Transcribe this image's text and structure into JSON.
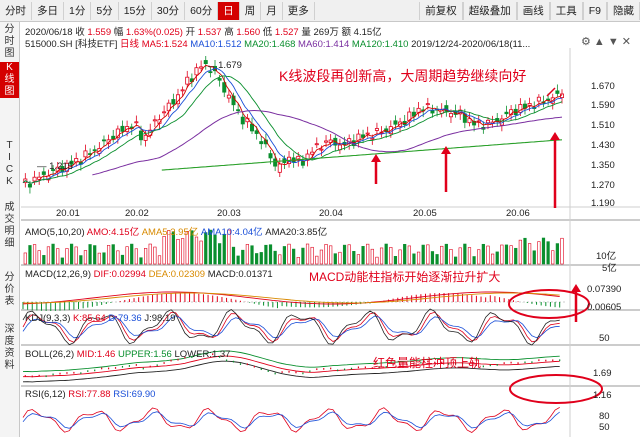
{
  "toolbar": {
    "left": [
      "分时",
      "多日",
      "1分",
      "5分",
      "15分",
      "30分",
      "60分",
      "日",
      "周",
      "月",
      "更多"
    ],
    "active": "日",
    "right": [
      "前复权",
      "超级叠加",
      "画线",
      "工具",
      "F9",
      "隐藏"
    ]
  },
  "sidebar": [
    {
      "label": "分\n时\n图",
      "active": false
    },
    {
      "label": "K\n线\n图",
      "active": true
    },
    {
      "label": "T\nI\nC\nK",
      "active": false
    },
    {
      "label": "成\n交\n明\n细",
      "active": false
    },
    {
      "label": "分\n价\n表",
      "active": false
    },
    {
      "label": "深\n度\n资\n料",
      "active": false
    }
  ],
  "header": {
    "date": "2020/06/18",
    "close_label": "收",
    "close_value": "1.559",
    "change_label": "幅",
    "change_value": "1.63%(0.025)",
    "open_label": "开",
    "open_value": "1.537",
    "high_label": "高",
    "high_value": "1.560",
    "low_label": "低",
    "low_value": "1.527",
    "volume_label": "量",
    "volume_value": "269万",
    "amount_label": "额",
    "amount_value": "4.15亿"
  },
  "ma_line": {
    "code": "515000.SH [科技ETF]",
    "period": "日线",
    "ma5": "MA5:1.524",
    "ma10": "MA10:1.512",
    "ma20": "MA20:1.468",
    "ma60": "MA60:1.414",
    "ma120": "MA120:1.410",
    "range": "2019/12/24-2020/06/18(11..."
  },
  "price_axis": [
    "1.670",
    "1.590",
    "1.510",
    "1.430",
    "1.350",
    "1.270",
    "1.190"
  ],
  "price_marks": {
    "high": "1.679",
    "low": "1.215"
  },
  "date_axis": [
    "20.01",
    "20.02",
    "20.03",
    "20.04",
    "20.05",
    "20.06"
  ],
  "annotations": {
    "main": "K线波段再创新高，大周期趋势继续向好",
    "macd": "MACD动能柱指标开始逐渐拉升扩大",
    "boll": "红色量能柱冲顶上轨"
  },
  "amo": {
    "label": "AMO(5,10,20)",
    "amo": "AMO:4.15亿",
    "amo5": "AMA5:3.95亿",
    "amo10": "AMA10:4.04亿",
    "amo20": "AMA20:3.85亿",
    "axis": [
      "10亿",
      "5亿"
    ]
  },
  "macd": {
    "label": "MACD(12,26,9)",
    "dif": "DIF:0.02994",
    "dea": "DEA:0.02309",
    "macd": "MACD:0.01371",
    "axis": [
      "0.07390",
      "0.00605"
    ]
  },
  "kdj": {
    "label": "KDJ(9,3,3)",
    "k": "K:85.64",
    "d": "D:79.36",
    "j": "J:98.19",
    "axis": [
      "50"
    ]
  },
  "boll": {
    "label": "BOLL(26,2)",
    "mid": "MID:1.46",
    "upper": "UPPER:1.56",
    "lower": "LOWER:1.37",
    "axis": [
      "1.69",
      "1.16"
    ]
  },
  "rsi": {
    "label": "RSI(6,12)",
    "rsi1": "RSI:77.88",
    "rsi2": "RSI:69.90",
    "axis": [
      "80",
      "50"
    ]
  },
  "colors": {
    "up": "#e0001b",
    "down": "#0a8f2e",
    "accent": "#d40000",
    "ma5": "#d40000",
    "ma10": "#1a4fd8",
    "ma20": "#0a8f2e",
    "ma60": "#7a2fa0",
    "ma120": "#2aa02a"
  }
}
